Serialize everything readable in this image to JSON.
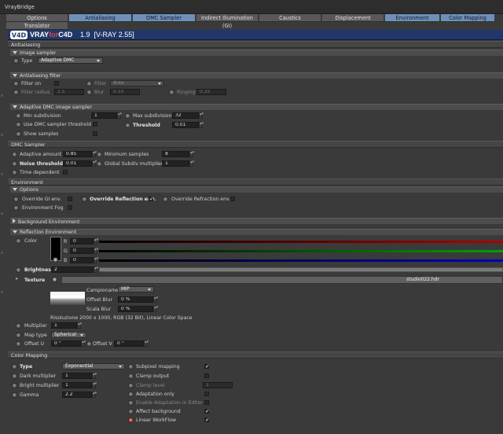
{
  "window": {
    "title": "VrayBridge"
  },
  "tabs": [
    {
      "label": "Options",
      "active": false
    },
    {
      "label": "Antialiasing",
      "active": true
    },
    {
      "label": "DMC Sampler",
      "active": true
    },
    {
      "label": "Indirect Illumination (GI)",
      "active": false
    },
    {
      "label": "Caustics",
      "active": false
    },
    {
      "label": "Displacement",
      "active": false
    },
    {
      "label": "Environment",
      "active": true
    },
    {
      "label": "Color Mapping",
      "active": true
    },
    {
      "label": "Translator",
      "active": false
    }
  ],
  "logo": {
    "brand": "VRAY",
    "brand_for": "for",
    "brand_c4d": "C4D",
    "version": "1.9",
    "build": "[V-RAY 2.55]"
  },
  "antialiasing": {
    "section_label": "Antialiasing",
    "image_sampler": {
      "label": "Image sampler",
      "type_label": "Type",
      "type_value": "Adaptive DMC"
    },
    "aa_filter": {
      "label": "Antialiasing filter",
      "filter_on_label": "Filter on",
      "filter_label": "Filter",
      "filter_value": "Area",
      "radius_label": "Filter radius",
      "radius_value": "1.5",
      "blur_label": "Blur",
      "blur_value": "0.33",
      "ringing_label": "Ringing",
      "ringing_value": "0.33"
    },
    "adaptive": {
      "label": "Adaptive DMC image sampler",
      "min_label": "Min subdivision",
      "min_value": "1",
      "max_label": "Max subdivision",
      "max_value": "32",
      "use_dmc_label": "Use DMC sampler threshold",
      "threshold_label": "Threshold",
      "threshold_value": "0.01",
      "show_label": "Show samples"
    }
  },
  "dmc": {
    "section_label": "DMC Sampler",
    "adaptive_label": "Adaptive amount",
    "adaptive_value": "0.85",
    "min_samples_label": "Minimum samples",
    "min_samples_value": "8",
    "noise_label": "Noise threshold",
    "noise_value": "0.01",
    "global_label": "Global Subdiv multiplier",
    "global_value": "1",
    "time_label": "Time dependent"
  },
  "environment": {
    "section_label": "Environment",
    "options": {
      "label": "Options",
      "gi_label": "Override GI env.",
      "refl_label": "Override Reflection env.",
      "refl_checked": "✓",
      "refr_label": "Override Refraction env.",
      "fog_label": "Environment Fog"
    },
    "background_label": "Background Environment",
    "reflection": {
      "label": "Reflection Environment",
      "color_label": "Color",
      "r_label": "R",
      "r_value": "0",
      "g_label": "G",
      "g_value": "0",
      "b_label": "B",
      "b_value": "0",
      "brightness_label": "Brightness",
      "brightness_value": "2",
      "texture_label": "Texture",
      "texture_file": "studio022.hdr",
      "campionamento_label": "Campionamento",
      "campionamento_value": "MIP",
      "offset_blur_label": "Offset Blur",
      "offset_blur_value": "0 %",
      "scala_blur_label": "Scala Blur",
      "scala_blur_value": "0 %",
      "resolution": "Risoluzione 2000 x 1000, RGB (32 Bit), Linear Color Space",
      "multiplier_label": "Multiplier",
      "multiplier_value": "1",
      "map_type_label": "Map type",
      "map_type_value": "Spherical",
      "offset_u_label": "Offset U",
      "offset_u_value": "0 °",
      "offset_v_label": "Offset V",
      "offset_v_value": "0 °"
    }
  },
  "color_mapping": {
    "section_label": "Color Mapping",
    "type_label": "Type",
    "type_value": "Exponential",
    "dark_label": "Dark multiplier",
    "dark_value": "1",
    "bright_label": "Bright multiplier",
    "bright_value": "1",
    "gamma_label": "Gamma",
    "gamma_value": "2.2",
    "subpixel_label": "Subpixel mapping",
    "clamp_output_label": "Clamp output",
    "clamp_level_label": "Clamp level",
    "clamp_level_value": "1",
    "adaptation_label": "Adaptation only",
    "enable_adapt_label": "Enable Adaptation in Editor",
    "affect_bg_label": "Affect background",
    "linear_label": "Linear WorkFlow"
  },
  "checks": {
    "mark": "✓"
  },
  "dots": ". . . . . . . ."
}
